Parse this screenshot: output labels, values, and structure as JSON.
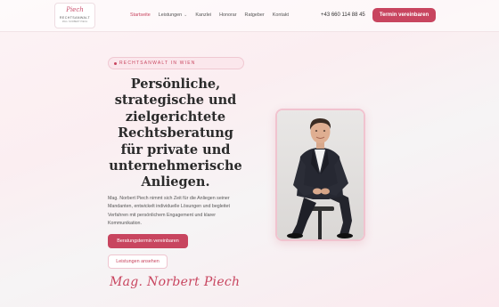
{
  "logo": {
    "script": "Piech",
    "word": "RECHTSANWALT",
    "sub": "MAG. NORBERT PIECH"
  },
  "nav": {
    "items": [
      {
        "label": "Startseite",
        "active": true
      },
      {
        "label": "Leistungen",
        "active": false,
        "has_dropdown": true
      },
      {
        "label": "Kanzlei",
        "active": false
      },
      {
        "label": "Honorar",
        "active": false
      },
      {
        "label": "Ratgeber",
        "active": false
      },
      {
        "label": "Kontakt",
        "active": false
      }
    ],
    "dropdown_icon": "chevron-down-icon"
  },
  "phone": "+43 660 114 88 45",
  "header_cta": "Termin vereinbaren",
  "hero": {
    "badge": "RECHTSANWALT IN WIEN",
    "headline": "Persönliche, strategische und zielgerichtete Rechtsberatung für private und unternehmerische Anliegen.",
    "intro": "Mag. Norbert Piech nimmt sich Zeit für die Anliegen seiner Mandanten, entwickelt individuelle Lösungen und begleitet Verfahren mit persönlichem Engagement und klarer Kommunikation.",
    "primary_button": "Beratungstermin vereinbaren",
    "secondary_button": "Leistungen ansehen",
    "signature": "Mag. Norbert Piech"
  },
  "colors": {
    "accent": "#c8455f",
    "badge_bg": "#fbe7ec"
  }
}
